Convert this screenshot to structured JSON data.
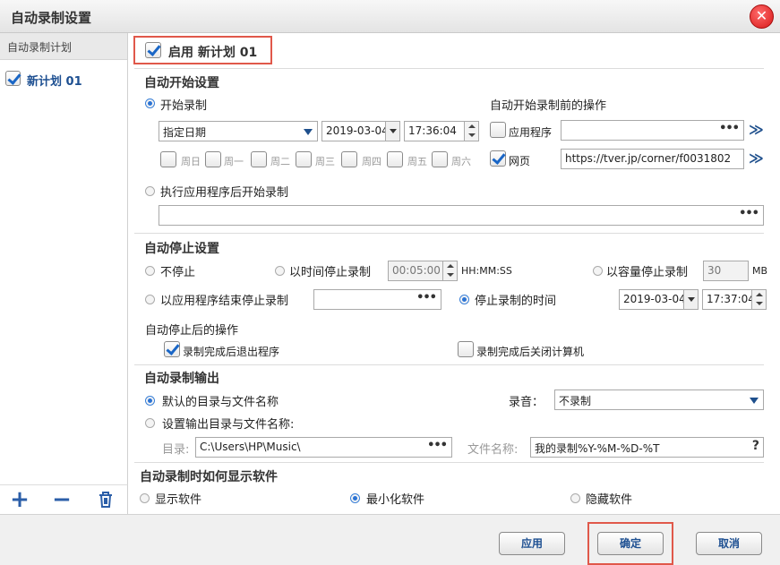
{
  "window": {
    "title": "自动录制设置",
    "close_label": "✕"
  },
  "sidebar": {
    "header": "自动录制计划",
    "items": [
      {
        "label": "新计划 01",
        "checked": true
      }
    ],
    "tools": {
      "add": "+",
      "remove": "−"
    }
  },
  "plan": {
    "enable_label": "启用 新计划 01",
    "enabled": true
  },
  "start": {
    "section_title": "自动开始设置",
    "mode_start_record": "开始录制",
    "date_mode": "指定日期",
    "date": "2019-03-04",
    "time": "17:36:04",
    "weekdays": [
      "周日",
      "周一",
      "周二",
      "周三",
      "周四",
      "周五",
      "周六"
    ],
    "mode_after_app": "执行应用程序后开始录制",
    "app_path": "",
    "pre_actions_title": "自动开始录制前的操作",
    "pre_app_label": "应用程序",
    "pre_app_path": "",
    "pre_web_label": "网页",
    "pre_web_url": "https://tver.jp/corner/f0031802",
    "dots": "•••",
    "go": "≫"
  },
  "stop": {
    "section_title": "自动停止设置",
    "no_stop": "不停止",
    "by_time": "以时间停止录制",
    "time_value": "00:05:00",
    "time_unit": "HH:MM:SS",
    "by_size": "以容量停止录制",
    "size_value": "30",
    "size_unit": "MB",
    "by_app_end": "以应用程序结束停止录制",
    "app_path": "",
    "stop_at_time": "停止录制的时间",
    "stop_date": "2019-03-04",
    "stop_time": "17:37:04",
    "after_title": "自动停止后的操作",
    "exit_app": "录制完成后退出程序",
    "exit_app_checked": true,
    "shutdown": "录制完成后关闭计算机",
    "shutdown_checked": false
  },
  "output": {
    "section_title": "自动录制输出",
    "default_name": "默认的目录与文件名称",
    "custom_name": "设置输出目录与文件名称:",
    "audio_label": "录音：",
    "audio_value": "不录制",
    "dir_label": "目录:",
    "dir_value": "C:\\Users\\HP\\Music\\",
    "filename_label": "文件名称:",
    "filename_value": "我的录制%Y-%M-%D-%T",
    "help": "?"
  },
  "display": {
    "section_title": "自动录制时如何显示软件",
    "show": "显示软件",
    "minimize": "最小化软件",
    "hide": "隐藏软件"
  },
  "footer": {
    "apply": "应用",
    "ok": "确定",
    "cancel": "取消"
  }
}
